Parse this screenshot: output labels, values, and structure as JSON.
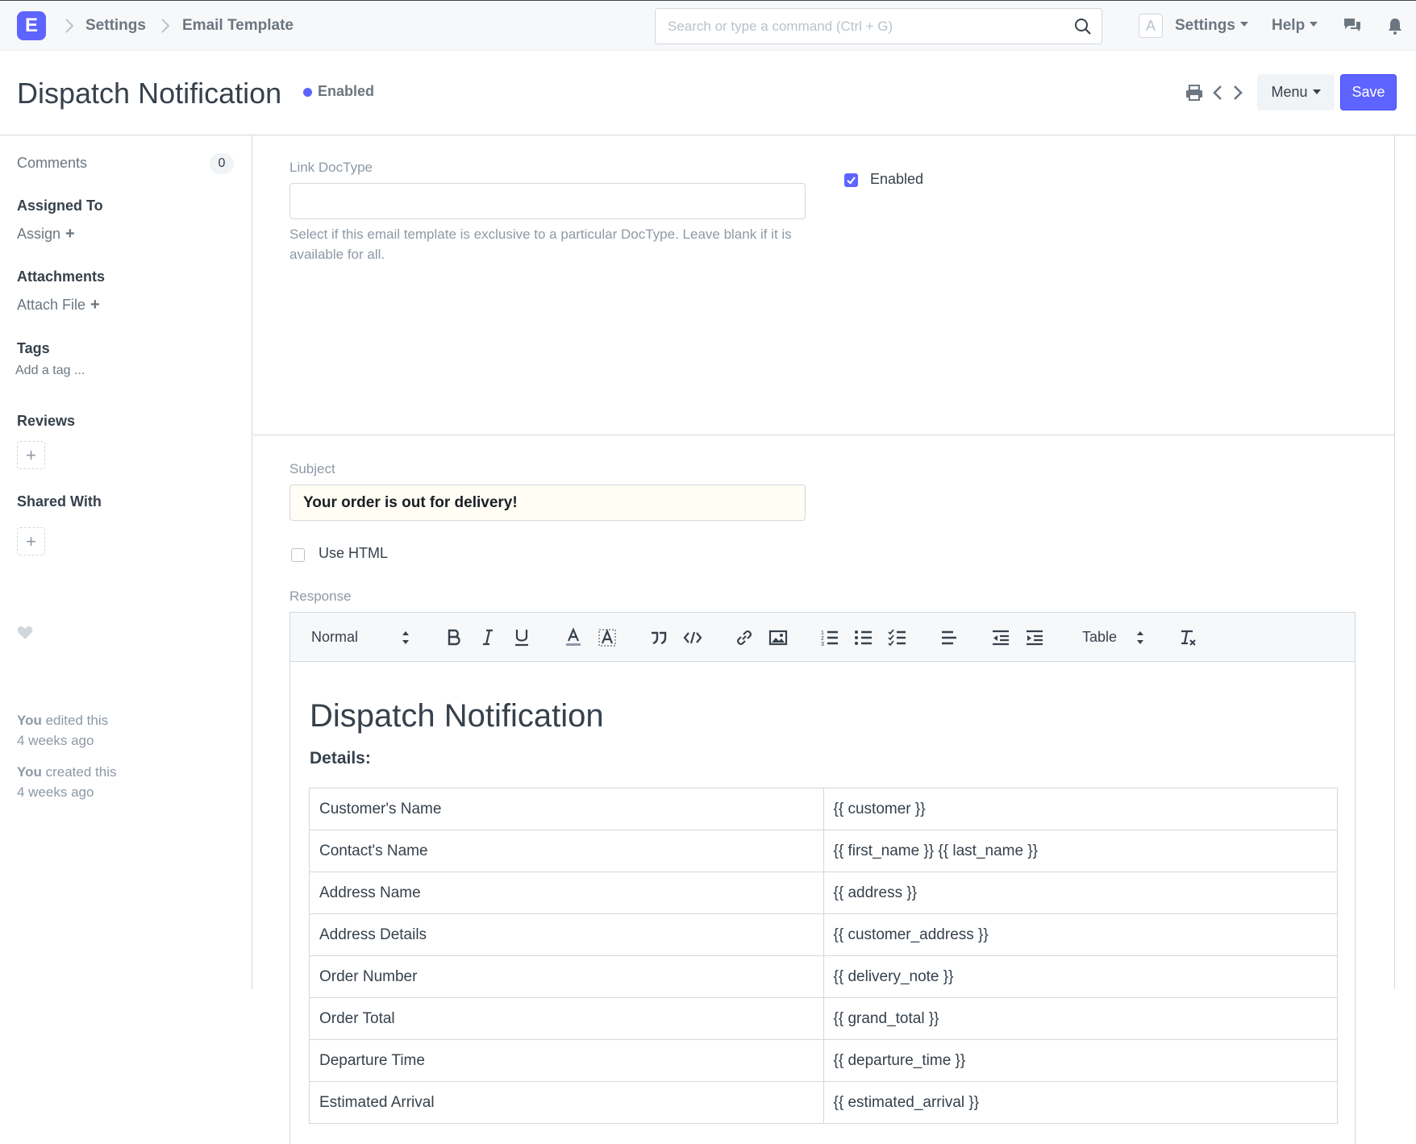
{
  "navbar": {
    "logo_letter": "E",
    "breadcrumbs": [
      "Settings",
      "Email Template"
    ],
    "search_placeholder": "Search or type a command (Ctrl + G)",
    "avatar_letter": "A",
    "settings_label": "Settings",
    "help_label": "Help"
  },
  "header": {
    "title": "Dispatch Notification",
    "status": "Enabled",
    "menu_label": "Menu",
    "save_label": "Save",
    "accent_color": "#5e64ff"
  },
  "sidebar": {
    "comments_label": "Comments",
    "comments_count": "0",
    "assigned_heading": "Assigned To",
    "assign_label": "Assign",
    "attachments_heading": "Attachments",
    "attach_label": "Attach File",
    "tags_heading": "Tags",
    "tag_placeholder": "Add a tag ...",
    "reviews_heading": "Reviews",
    "shared_heading": "Shared With",
    "activity": [
      {
        "who": "You",
        "action": "edited this",
        "when": "4 weeks ago"
      },
      {
        "who": "You",
        "action": "created this",
        "when": "4 weeks ago"
      }
    ]
  },
  "form": {
    "link_doctype_label": "Link DocType",
    "link_doctype_value": "",
    "link_doctype_help": "Select if this email template is exclusive to a particular DocType. Leave blank if it is available for all.",
    "enabled_label": "Enabled",
    "enabled_checked": true,
    "subject_label": "Subject",
    "subject_value": "Your order is out for delivery!",
    "use_html_label": "Use HTML",
    "use_html_checked": false,
    "response_label": "Response"
  },
  "editor": {
    "format_select": "Normal",
    "table_select": "Table",
    "content_title": "Dispatch Notification",
    "content_subtitle": "Details:",
    "rows": [
      [
        "Customer's Name",
        "{{ customer }}"
      ],
      [
        "Contact's Name",
        "{{ first_name }} {{ last_name }}"
      ],
      [
        "Address Name",
        "{{ address }}"
      ],
      [
        "Address Details",
        "{{ customer_address }}"
      ],
      [
        "Order Number",
        "{{ delivery_note }}"
      ],
      [
        "Order Total",
        "{{ grand_total }}"
      ],
      [
        "Departure Time",
        "{{ departure_time }}"
      ],
      [
        "Estimated Arrival",
        "{{ estimated_arrival }}"
      ]
    ]
  }
}
